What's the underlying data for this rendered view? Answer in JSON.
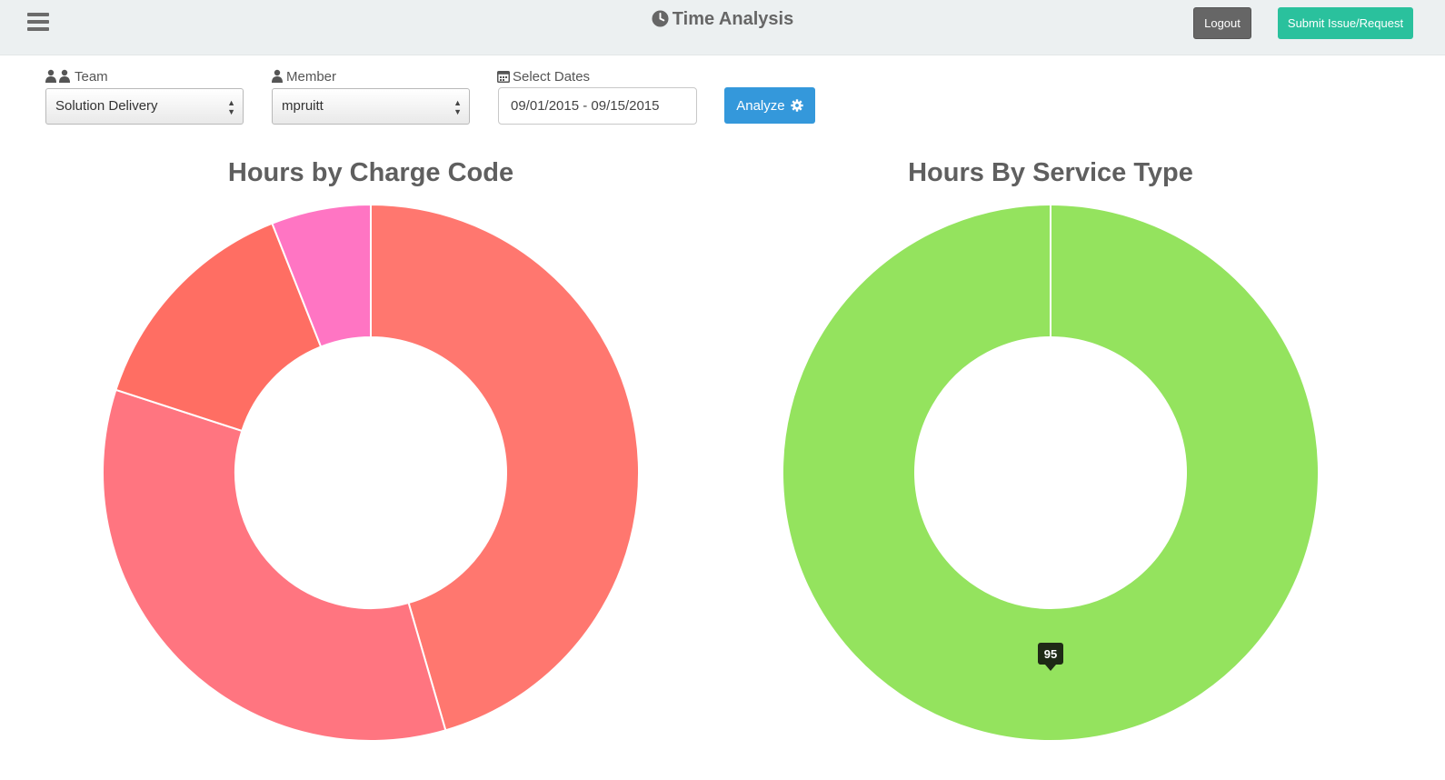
{
  "header": {
    "title": "Time Analysis",
    "logout_label": "Logout",
    "submit_label": "Submit Issue/Request"
  },
  "filters": {
    "team": {
      "label": "Team",
      "value": "Solution Delivery"
    },
    "member": {
      "label": "Member",
      "value": "mpruitt"
    },
    "dates": {
      "label": "Select Dates",
      "value": "09/01/2015 - 09/15/2015"
    },
    "analyze_label": "Analyze"
  },
  "chart_data": [
    {
      "type": "pie",
      "title": "Hours by Charge Code",
      "donut": true,
      "values": [
        45.5,
        34.5,
        14,
        6
      ],
      "colors": [
        "#ff776f",
        "#ff7580",
        "#ff6e63",
        "#ff75c3"
      ]
    },
    {
      "type": "pie",
      "title": "Hours By Service Type",
      "donut": true,
      "values": [
        95
      ],
      "colors": [
        "#94e35e"
      ],
      "data_labels": [
        "95"
      ]
    }
  ],
  "colors": {
    "topbar": "#ecf0f1",
    "logout": "#666666",
    "submit": "#2ac19d",
    "analyze": "#3498db"
  }
}
